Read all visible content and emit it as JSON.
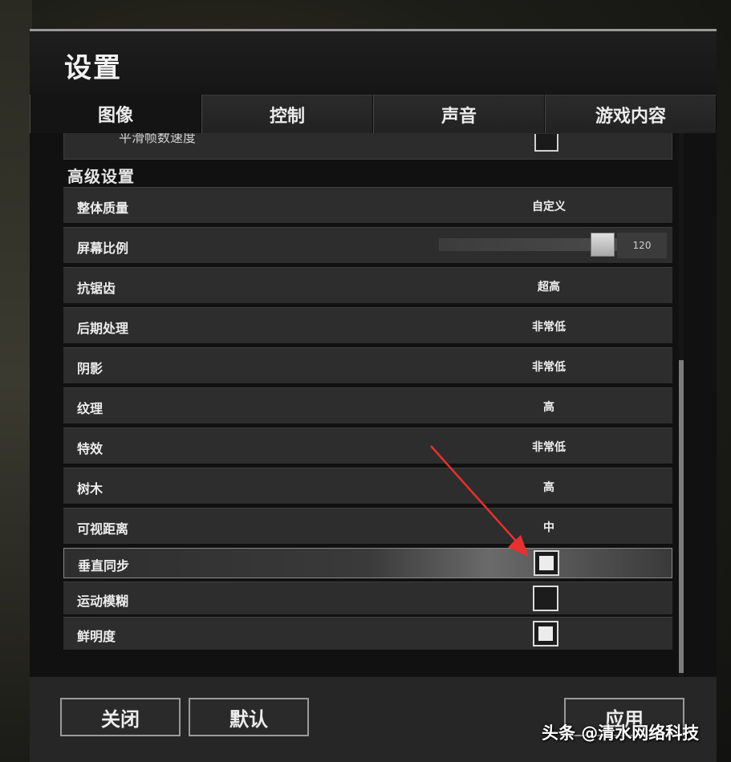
{
  "window": {
    "title": "设置"
  },
  "tabs": [
    {
      "label": "图像",
      "active": true
    },
    {
      "label": "控制",
      "active": false
    },
    {
      "label": "声音",
      "active": false
    },
    {
      "label": "游戏内容",
      "active": false
    }
  ],
  "partial_row": {
    "label": "平滑帧数速度",
    "checked": false
  },
  "advanced": {
    "section_title": "高级设置",
    "rows": [
      {
        "label": "整体质量",
        "value": "自定义"
      },
      {
        "label": "屏幕比例",
        "slider_value": "120",
        "slider_fraction": 0.88
      },
      {
        "label": "抗锯齿",
        "value": "超高"
      },
      {
        "label": "后期处理",
        "value": "非常低"
      },
      {
        "label": "阴影",
        "value": "非常低"
      },
      {
        "label": "纹理",
        "value": "高"
      },
      {
        "label": "特效",
        "value": "非常低"
      },
      {
        "label": "树木",
        "value": "高"
      },
      {
        "label": "可视距离",
        "value": "中"
      },
      {
        "label": "垂直同步",
        "checked": true
      },
      {
        "label": "运动模糊",
        "checked": false
      },
      {
        "label": "鲜明度",
        "checked": true
      }
    ]
  },
  "footer": {
    "close_label": "关闭",
    "default_label": "默认",
    "apply_label": "应用"
  },
  "watermark": "头条 @清水网络科技",
  "colors": {
    "annotation_arrow": "#e8302f",
    "scroll_thumb": "#7c7c7c"
  }
}
